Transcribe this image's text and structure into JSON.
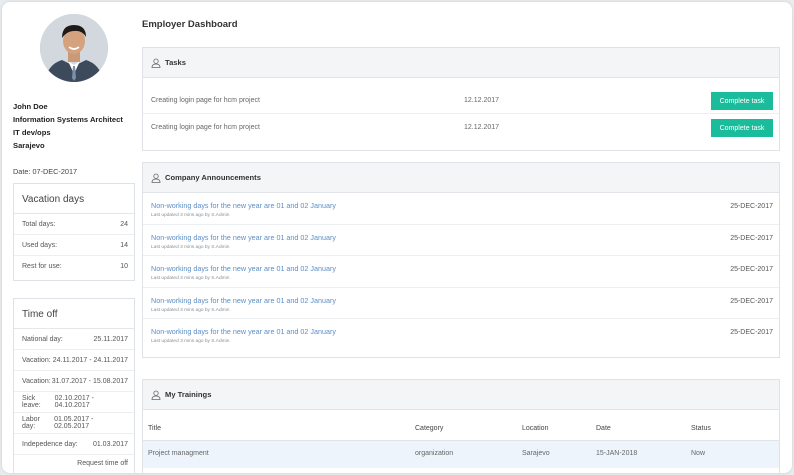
{
  "profile": {
    "name": "John Doe",
    "role": "Information Systems Architect",
    "department": "IT dev/ops",
    "city": "Sarajevo",
    "date": "Date: 07-DEC-2017"
  },
  "vacation": {
    "title": "Vacation days",
    "rows": [
      {
        "label": "Total days:",
        "value": "24"
      },
      {
        "label": "Used days:",
        "value": "14"
      },
      {
        "label": "Rest for use:",
        "value": "10"
      }
    ]
  },
  "timeoff": {
    "title": "Time off",
    "rows": [
      {
        "label": "National day:",
        "value": "25.11.2017"
      },
      {
        "label": "Vacation:",
        "value": "24.11.2017 - 24.11.2017"
      },
      {
        "label": "Vacation:",
        "value": "31.07.2017 - 15.08.2017"
      },
      {
        "label": "Sick leave:",
        "value": "02.10.2017 - 04.10.2017"
      },
      {
        "label": "Labor day:",
        "value": "01.05.2017 - 02.05.2017"
      },
      {
        "label": "Indepedence day:",
        "value": "01.03.2017"
      }
    ],
    "request_label": "Request time off"
  },
  "page_title": "Employer Dashboard",
  "tasks": {
    "title": "Tasks",
    "rows": [
      {
        "title": "Creating login page for hcm project",
        "date": "12.12.2017",
        "action": "Complete task"
      },
      {
        "title": "Creating login page for hcm project",
        "date": "12.12.2017",
        "action": "Complete task"
      }
    ]
  },
  "announcements": {
    "title": "Company Announcements",
    "rows": [
      {
        "title": "Non-working days for the new year are 01 and 02 January",
        "meta": "Last updated 3 mins ago by S.Admin",
        "date": "25-DEC-2017"
      },
      {
        "title": "Non-working days for the new year are 01 and 02 January",
        "meta": "Last updated 3 mins ago by S.Admin",
        "date": "25-DEC-2017"
      },
      {
        "title": "Non-working days for the new year are 01 and 02 January",
        "meta": "Last updated 3 mins ago by S.Admin",
        "date": "25-DEC-2017"
      },
      {
        "title": "Non-working days for the new year are 01 and 02 January",
        "meta": "Last updated 3 mins ago by S.Admin",
        "date": "25-DEC-2017"
      },
      {
        "title": "Non-working days for the new year are 01 and 02 January",
        "meta": "Last updated 3 mins ago by S.Admin",
        "date": "25-DEC-2017"
      }
    ]
  },
  "trainings": {
    "title": "My Trainings",
    "columns": [
      "Title",
      "Category",
      "Location",
      "Date",
      "Status"
    ],
    "rows": [
      [
        "Project managment",
        "organization",
        "Sarajevo",
        "15-JAN-2018",
        "Now"
      ]
    ]
  },
  "colors": {
    "accent": "#1abc9c",
    "link": "#5b8fc7"
  },
  "icons": {
    "panel_header": "user-icon"
  }
}
